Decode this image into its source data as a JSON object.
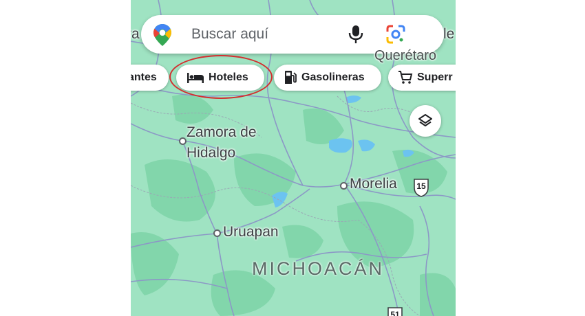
{
  "search": {
    "placeholder": "Buscar aquí"
  },
  "chips": [
    {
      "label": "antes",
      "icon": "restaurant-icon"
    },
    {
      "label": "Hoteles",
      "icon": "bed-icon",
      "highlighted": true
    },
    {
      "label": "Gasolineras",
      "icon": "gas-station-icon"
    },
    {
      "label": "Superr",
      "icon": "cart-icon"
    }
  ],
  "map_labels": {
    "zamora": "Zamora de\nHidalgo",
    "morelia": "Morelia",
    "uruapan": "Uruapan",
    "state": "MICHOACÁN",
    "queretaro": "Querétaro",
    "edge_left": "ra",
    "edge_right": "le",
    "highway_15": "15",
    "highway_51": "51"
  },
  "colors": {
    "map_base": "#9fe3c2",
    "forest": "#7fd5a8",
    "water": "#6cc3f0",
    "road": "#8c98c6",
    "highlight_circle": "#d32f2f"
  }
}
